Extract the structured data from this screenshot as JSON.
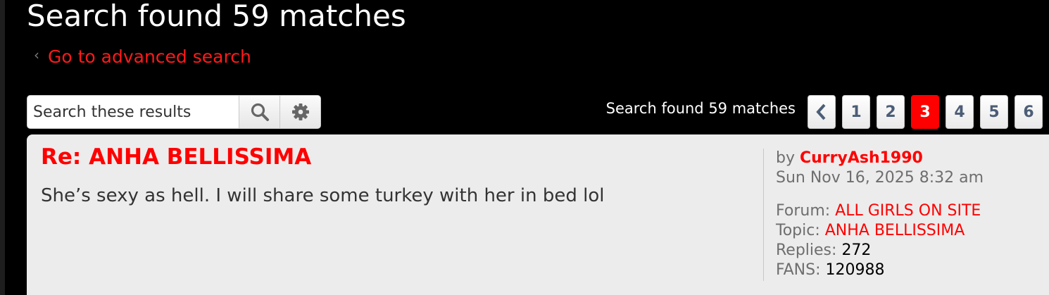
{
  "header": {
    "title": "Search found 59 matches",
    "advanced_search_link": "Go to advanced search"
  },
  "search": {
    "placeholder": "Search these results"
  },
  "icons": {
    "search_button": "search-icon",
    "advanced_options_button": "gear-icon",
    "back_link": "chevron-left-icon",
    "previous_page": "chevron-left-icon"
  },
  "pagination": {
    "summary": "Search found 59 matches",
    "pages": [
      "1",
      "2",
      "3",
      "4",
      "5",
      "6"
    ],
    "current_page": "3"
  },
  "result": {
    "title": "Re: ANHA BELLISSIMA",
    "excerpt": "She’s sexy as hell. I will share some turkey with her in bed lol",
    "by_label": "by",
    "author": "CurryAsh1990",
    "date": "Sun Nov 16, 2025 8:32 am",
    "forum_label": "Forum:",
    "forum": "ALL GIRLS ON SITE",
    "topic_label": "Topic:",
    "topic": "ANHA BELLISSIMA",
    "replies_label": "Replies:",
    "replies": "272",
    "fans_label": "FANS:",
    "fans": "120988"
  },
  "colors": {
    "background": "#000000",
    "accent": "#ff0000",
    "card_background": "#ececec",
    "pagination_text": "#4c5d77"
  }
}
